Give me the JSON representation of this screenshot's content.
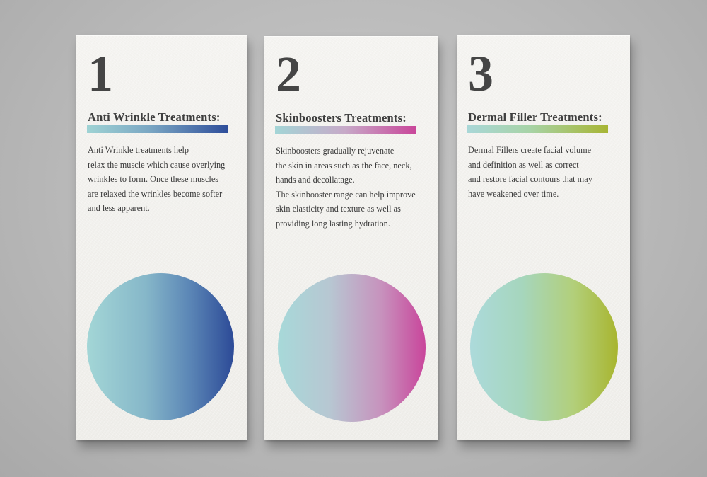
{
  "cards": [
    {
      "number": "1",
      "title": "Anti Wrinkle Treatments:",
      "lines": [
        "Anti Wrinkle treatments help",
        "relax the muscle which cause overlying",
        "wrinkles to form. Once these muscles",
        "are relaxed the wrinkles become softer",
        "and less apparent."
      ],
      "gradient": [
        "#a3d6d6",
        "#2c4a97"
      ]
    },
    {
      "number": "2",
      "title": "Skinboosters Treatments:",
      "lines": [
        "Skinboosters gradually rejuvenate",
        "the skin in areas such as the face, neck,",
        "hands and decollatage.",
        "The skinbooster range can help improve",
        "skin elasticity and texture as well as",
        "providing long lasting hydration."
      ],
      "gradient": [
        "#a7d9d9",
        "#c9459b"
      ]
    },
    {
      "number": "3",
      "title": "Dermal Filler Treatments:",
      "lines": [
        "Dermal Fillers create facial volume",
        "and definition as well as correct",
        "and restore facial contours that may",
        "have weakened over time."
      ],
      "gradient": [
        "#acdadb",
        "#a8b52f"
      ]
    }
  ]
}
